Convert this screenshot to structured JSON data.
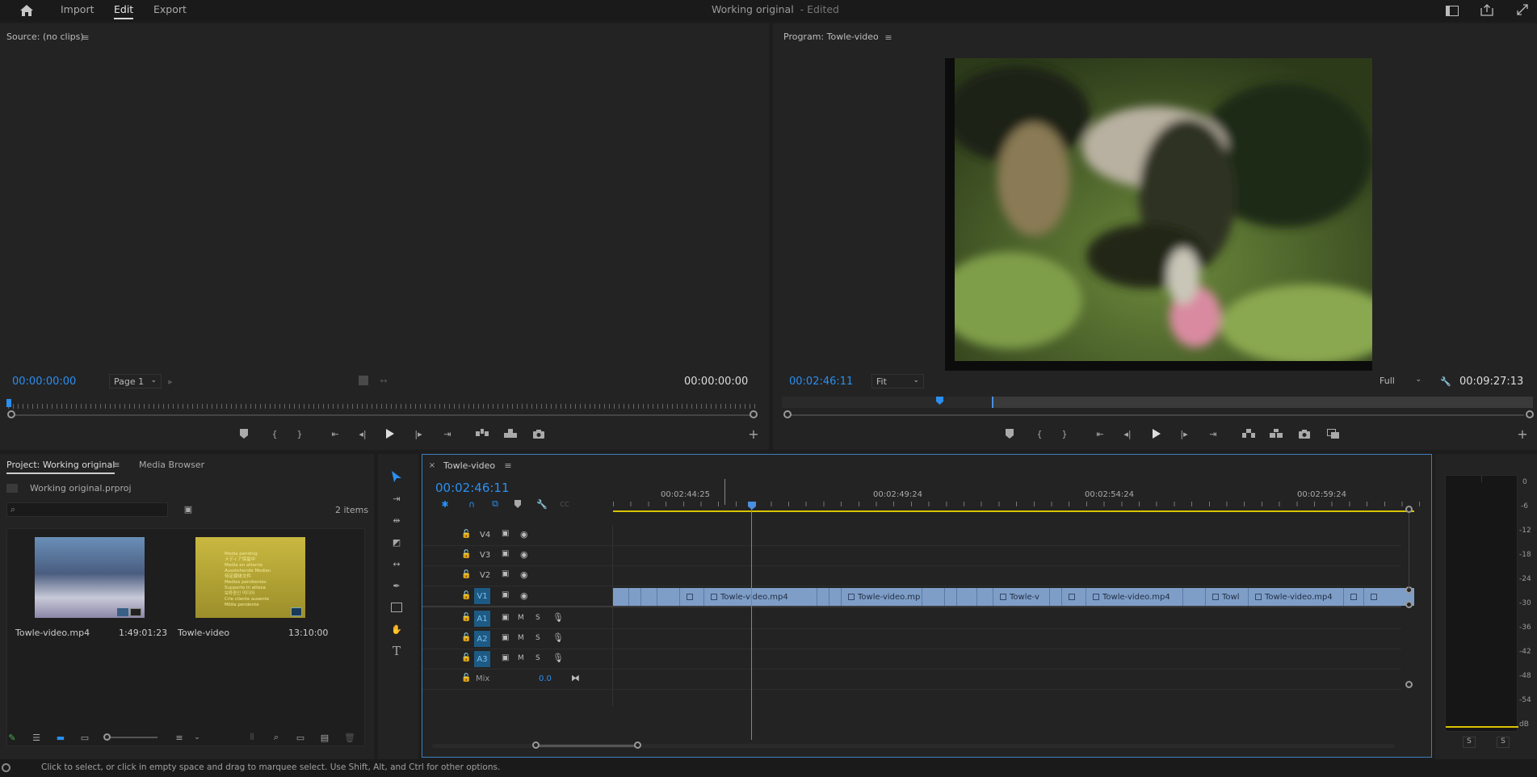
{
  "topbar": {
    "nav": [
      "Import",
      "Edit",
      "Export"
    ],
    "title": "Working original",
    "title_suffix": "- Edited"
  },
  "source": {
    "header": "Source: (no clips)",
    "timecode_left": "00:00:00:00",
    "page_select": "Page 1",
    "timecode_right": "00:00:00:00"
  },
  "program": {
    "header": "Program: Towle-video",
    "timecode": "00:02:46:11",
    "fit_select": "Fit",
    "quality_select": "Full",
    "duration": "00:09:27:13"
  },
  "project": {
    "tab_active": "Project: Working original",
    "tab_other": "Media Browser",
    "file": "Working original.prproj",
    "count": "2 items",
    "items": [
      {
        "name": "Towle-video.mp4",
        "duration": "1:49:01:23"
      },
      {
        "name": "Towle-video",
        "duration": "13:10:00"
      }
    ],
    "thumb2_lines": [
      "Media pending",
      "メディア保留中",
      "Media en attente",
      "Ausstehende Medien",
      "待定媒体文件",
      "Medios pendientes",
      "Supporto in attesa",
      "보류중인 미디어",
      "Crie cliente ausente",
      "Mídia pendente"
    ]
  },
  "timeline": {
    "tab": "Towle-video",
    "timecode": "00:02:46:11",
    "ruler": [
      "00:02:44:25",
      "00:02:49:24",
      "00:02:54:24",
      "00:02:59:24"
    ],
    "video_tracks": [
      "V4",
      "V3",
      "V2",
      "V1"
    ],
    "audio_tracks": [
      "A1",
      "A2",
      "A3"
    ],
    "audio_btn_m": "M",
    "audio_btn_s": "S",
    "mix_label": "Mix",
    "mix_value": "0.0",
    "clips": [
      "Towle-video.mp4",
      "Towle-video.mp",
      "Towle-v",
      "Towle-video.mp4",
      "Towl",
      "Towle-video.mp4"
    ]
  },
  "meter": {
    "labels": [
      "0",
      "-6",
      "-12",
      "-18",
      "-24",
      "-30",
      "-36",
      "-42",
      "-48",
      "-54",
      "dB"
    ],
    "solo": [
      "S",
      "S"
    ]
  },
  "status": {
    "text": "Click to select, or click in empty space and drag to marquee select. Use Shift, Alt, and Ctrl for other options."
  },
  "colors": {
    "accent": "#2b8ff0",
    "clip": "#7f9ec7",
    "playhead": "#4a8fe0",
    "workarea": "#d9c300"
  }
}
